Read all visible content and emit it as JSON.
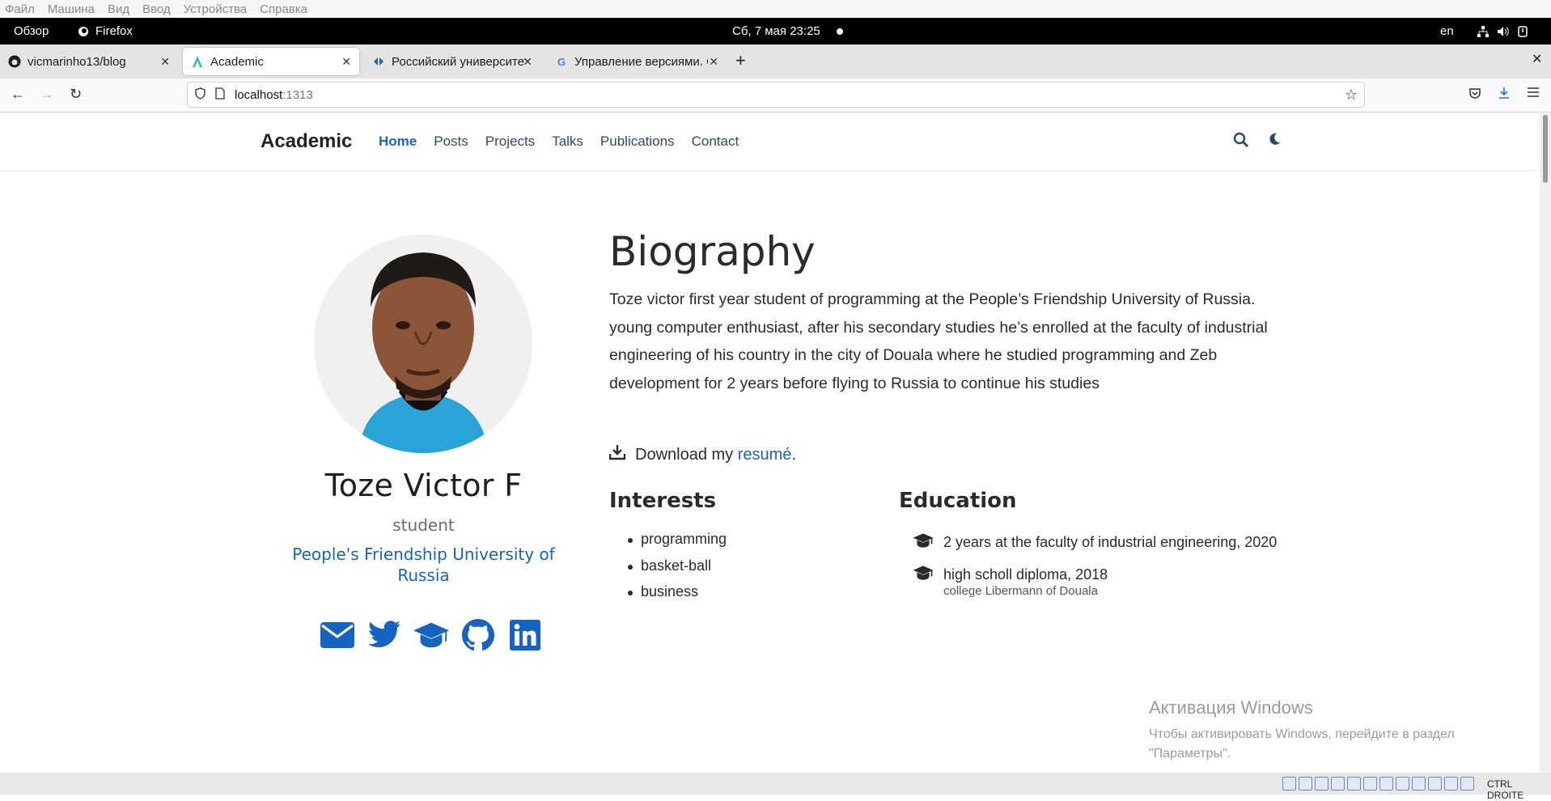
{
  "vbox_menu": [
    "Файл",
    "Машина",
    "Вид",
    "Ввод",
    "Устройства",
    "Справка"
  ],
  "gnome": {
    "overview": "Обзор",
    "app": "Firefox",
    "clock": "Сб, 7 мая  23:25",
    "lang": "en"
  },
  "tabs": [
    {
      "title": "vicmarinho13/blog",
      "icon": "github-icon"
    },
    {
      "title": "Academic",
      "icon": "academic-icon"
    },
    {
      "title": "Российский университет",
      "icon": "rudn-icon"
    },
    {
      "title": "Управление версиями. G",
      "icon": "google-icon"
    }
  ],
  "url": {
    "host": "localhost",
    "port": ":1313"
  },
  "site": {
    "brand": "Academic",
    "menu": [
      "Home",
      "Posts",
      "Projects",
      "Talks",
      "Publications",
      "Contact"
    ],
    "active": "Home"
  },
  "profile": {
    "name": "Toze Victor F",
    "role": "student",
    "organization": "People's Friendship University of Russia",
    "social": [
      "envelope-icon",
      "twitter-icon",
      "graduation-cap-icon",
      "github-icon",
      "linkedin-icon"
    ]
  },
  "biography": {
    "title": "Biography",
    "text": "Toze victor first year student of programming at the People’s Friendship University of Russia. young computer enthusiast, after his secondary studies he’s enrolled at the faculty of industrial engineering of his country in the city of Douala where he studied programming and Zeb development for 2 years before flying to Russia to continue his studies",
    "download_prefix": "Download my ",
    "download_link": "resumé",
    "download_suffix": "."
  },
  "interests": {
    "title": "Interests",
    "items": [
      "programming",
      "basket-ball",
      "business"
    ]
  },
  "education": {
    "title": "Education",
    "items": [
      {
        "course": "2 years at the faculty of industrial engineering, 2020",
        "institution": ""
      },
      {
        "course": "high scholl diploma, 2018",
        "institution": "college Libermann of Douala"
      }
    ]
  },
  "watermark": {
    "line1": "Активация Windows",
    "line2": "Чтобы активировать Windows, перейдите в раздел",
    "line3": "\"Параметры\"."
  },
  "vbox_status": {
    "host_key": "CTRL DROITE"
  },
  "colors": {
    "accent": "#1565c0",
    "text": "#2a2a2a"
  }
}
